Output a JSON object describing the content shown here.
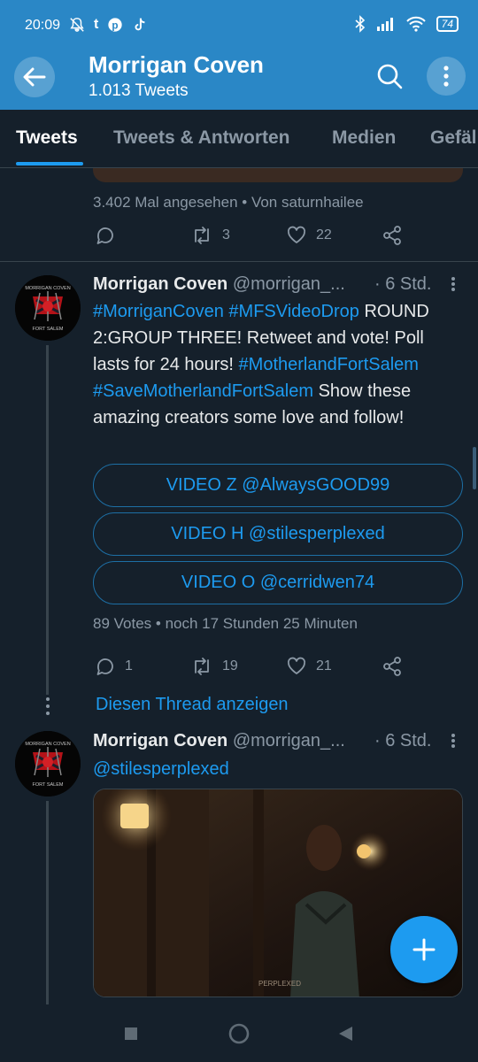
{
  "status_bar": {
    "time": "20:09",
    "app_icons": [
      "mute-icon",
      "tumblr-icon",
      "pinterest-icon",
      "tiktok-icon"
    ],
    "battery": "74"
  },
  "header": {
    "title": "Morrigan Coven",
    "subtitle": "1.013 Tweets"
  },
  "tabs": [
    {
      "label": "Tweets",
      "active": true
    },
    {
      "label": "Tweets & Antworten",
      "active": false
    },
    {
      "label": "Medien",
      "active": false
    },
    {
      "label": "Gefäl",
      "active": false
    }
  ],
  "prev_tweet": {
    "views": "3.402 Mal angesehen",
    "separator": "•",
    "source": "Von saturnhailee",
    "retweets": "3",
    "likes": "22"
  },
  "tweet1": {
    "name": "Morrigan Coven",
    "handle": "@morrigan_...",
    "time": "· 6 Std.",
    "hashtag1": "#MorriganCoven",
    "hashtag2": "#MFSVideoDrop",
    "text1": "ROUND 2:GROUP THREE! Retweet and vote! Poll lasts for 24 hours!",
    "hashtag3": "#MotherlandFortSalem",
    "hashtag4": "#SaveMotherlandFortSalem",
    "text2": "Show these amazing creators some love and follow!",
    "poll_options": [
      "VIDEO Z @AlwaysGOOD99",
      "VIDEO H @stilesperplexed",
      "VIDEO O @cerridwen74"
    ],
    "poll_meta": "89 Votes • noch 17 Stunden 25 Minuten",
    "replies": "1",
    "retweets": "19",
    "likes": "21"
  },
  "show_thread": "Diesen Thread anzeigen",
  "tweet2": {
    "name": "Morrigan Coven",
    "handle": "@morrigan_...",
    "time": "· 6 Std.",
    "mention": "@stilesperplexed",
    "media_watermark": "PERPLEXED"
  },
  "avatar_text": {
    "top": "MORRIGAN COVEN",
    "bottom": "FORT SALEM"
  },
  "colors": {
    "header": "#2a87c6",
    "background": "#15202b",
    "accent": "#1d9bf0"
  }
}
